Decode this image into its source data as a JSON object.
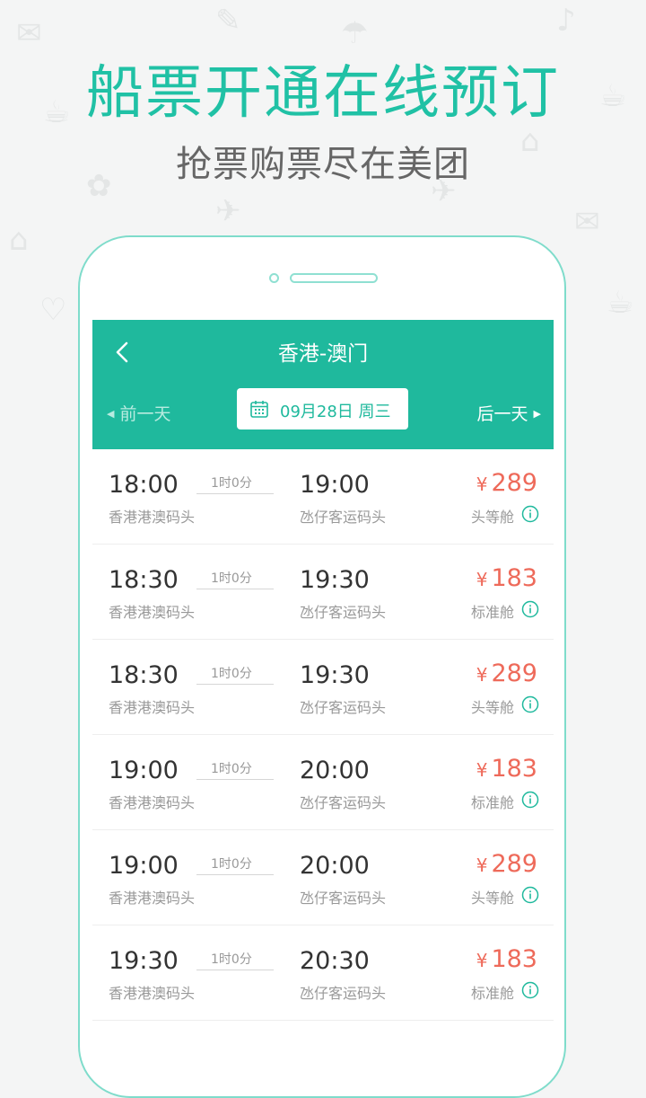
{
  "promo": {
    "headline": "船票开通在线预订",
    "subline": "抢票购票尽在美团"
  },
  "appbar": {
    "title": "香港-澳门",
    "prev_day": "前一天",
    "next_day": "后一天",
    "date": "09月28日 周三"
  },
  "colors": {
    "accent": "#1fb99d",
    "headline": "#20c1a5",
    "price": "#ee6a5a"
  },
  "trips": [
    {
      "dep_time": "18:00",
      "dep_port": "香港港澳码头",
      "duration": "1时0分",
      "arr_time": "19:00",
      "arr_port": "氹仔客运码头",
      "currency": "¥",
      "price": "289",
      "cabin": "头等舱"
    },
    {
      "dep_time": "18:30",
      "dep_port": "香港港澳码头",
      "duration": "1时0分",
      "arr_time": "19:30",
      "arr_port": "氹仔客运码头",
      "currency": "¥",
      "price": "183",
      "cabin": "标准舱"
    },
    {
      "dep_time": "18:30",
      "dep_port": "香港港澳码头",
      "duration": "1时0分",
      "arr_time": "19:30",
      "arr_port": "氹仔客运码头",
      "currency": "¥",
      "price": "289",
      "cabin": "头等舱"
    },
    {
      "dep_time": "19:00",
      "dep_port": "香港港澳码头",
      "duration": "1时0分",
      "arr_time": "20:00",
      "arr_port": "氹仔客运码头",
      "currency": "¥",
      "price": "183",
      "cabin": "标准舱"
    },
    {
      "dep_time": "19:00",
      "dep_port": "香港港澳码头",
      "duration": "1时0分",
      "arr_time": "20:00",
      "arr_port": "氹仔客运码头",
      "currency": "¥",
      "price": "289",
      "cabin": "头等舱"
    },
    {
      "dep_time": "19:30",
      "dep_port": "香港港澳码头",
      "duration": "1时0分",
      "arr_time": "20:30",
      "arr_port": "氹仔客运码头",
      "currency": "¥",
      "price": "183",
      "cabin": "标准舱"
    }
  ]
}
